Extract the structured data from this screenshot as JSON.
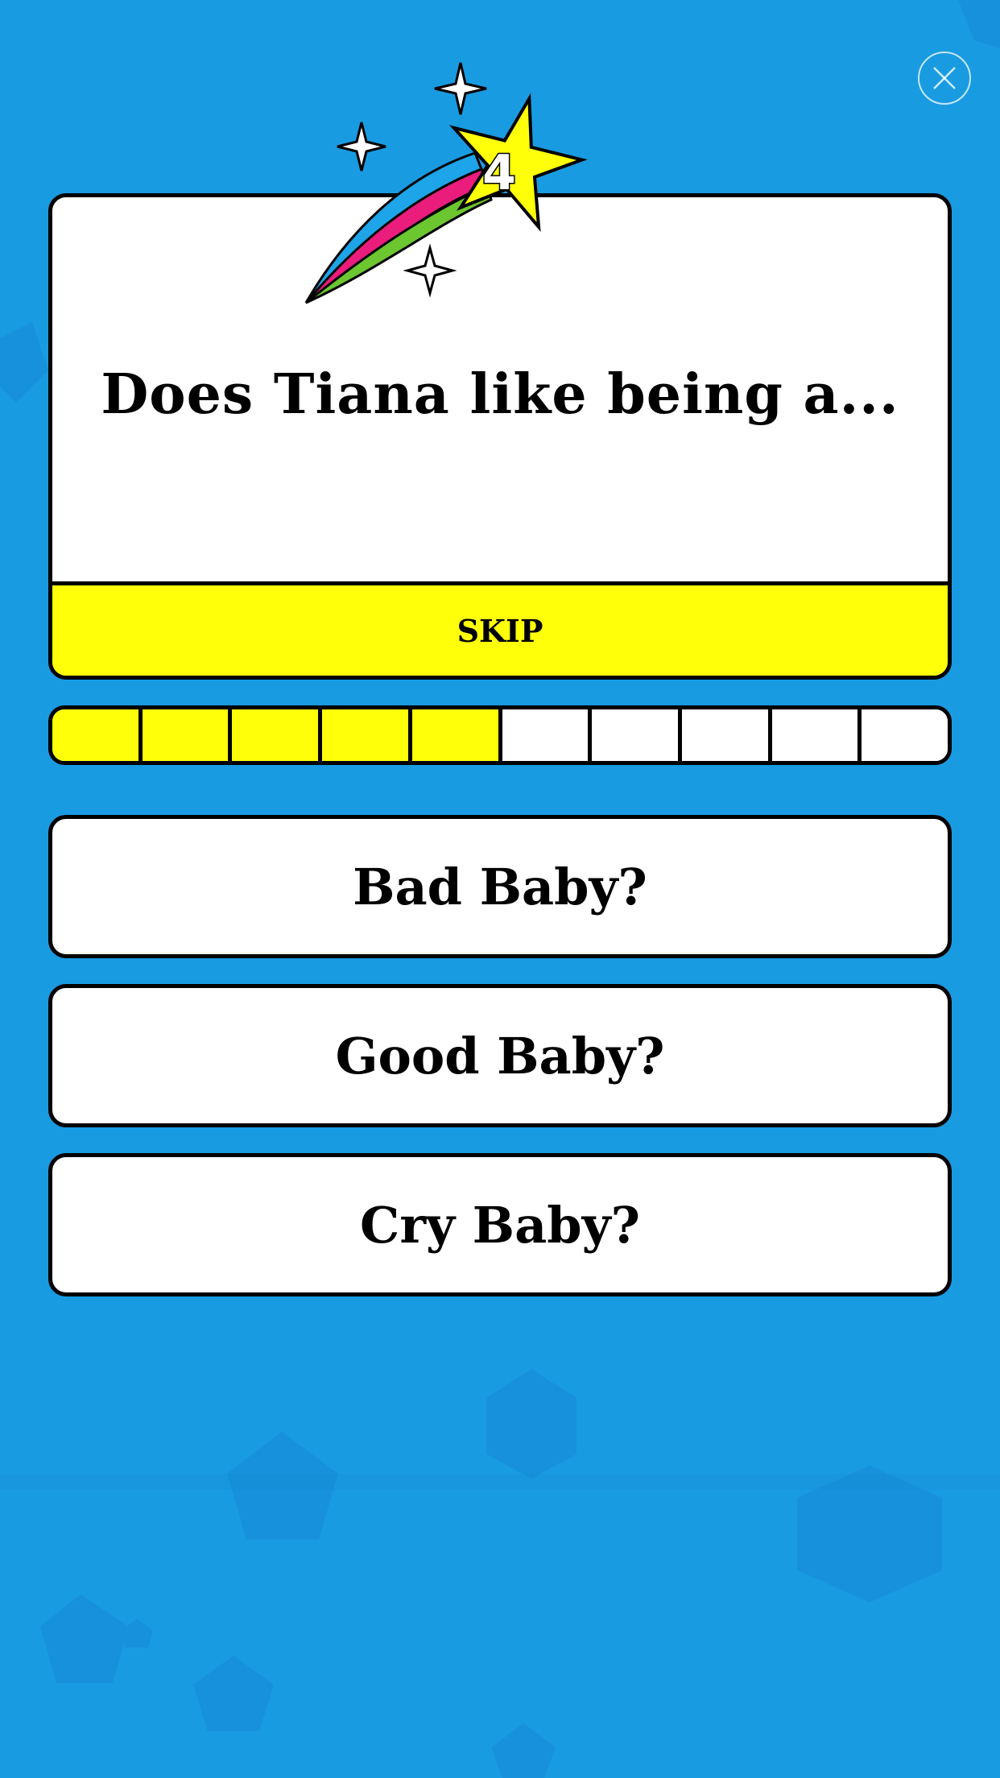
{
  "quiz": {
    "question_number": "4",
    "question": "Does Tiana like being a...",
    "skip_label": "SKIP",
    "progress": {
      "completed": 5,
      "total": 10
    },
    "answers": [
      "Bad Baby?",
      "Good Baby?",
      "Cry Baby?"
    ]
  },
  "icons": {
    "close": "close-icon",
    "badge": "shooting-star-icon"
  },
  "colors": {
    "background": "#199be2",
    "accent_yellow": "#ffff0a",
    "outline": "#000000",
    "card": "#ffffff"
  }
}
